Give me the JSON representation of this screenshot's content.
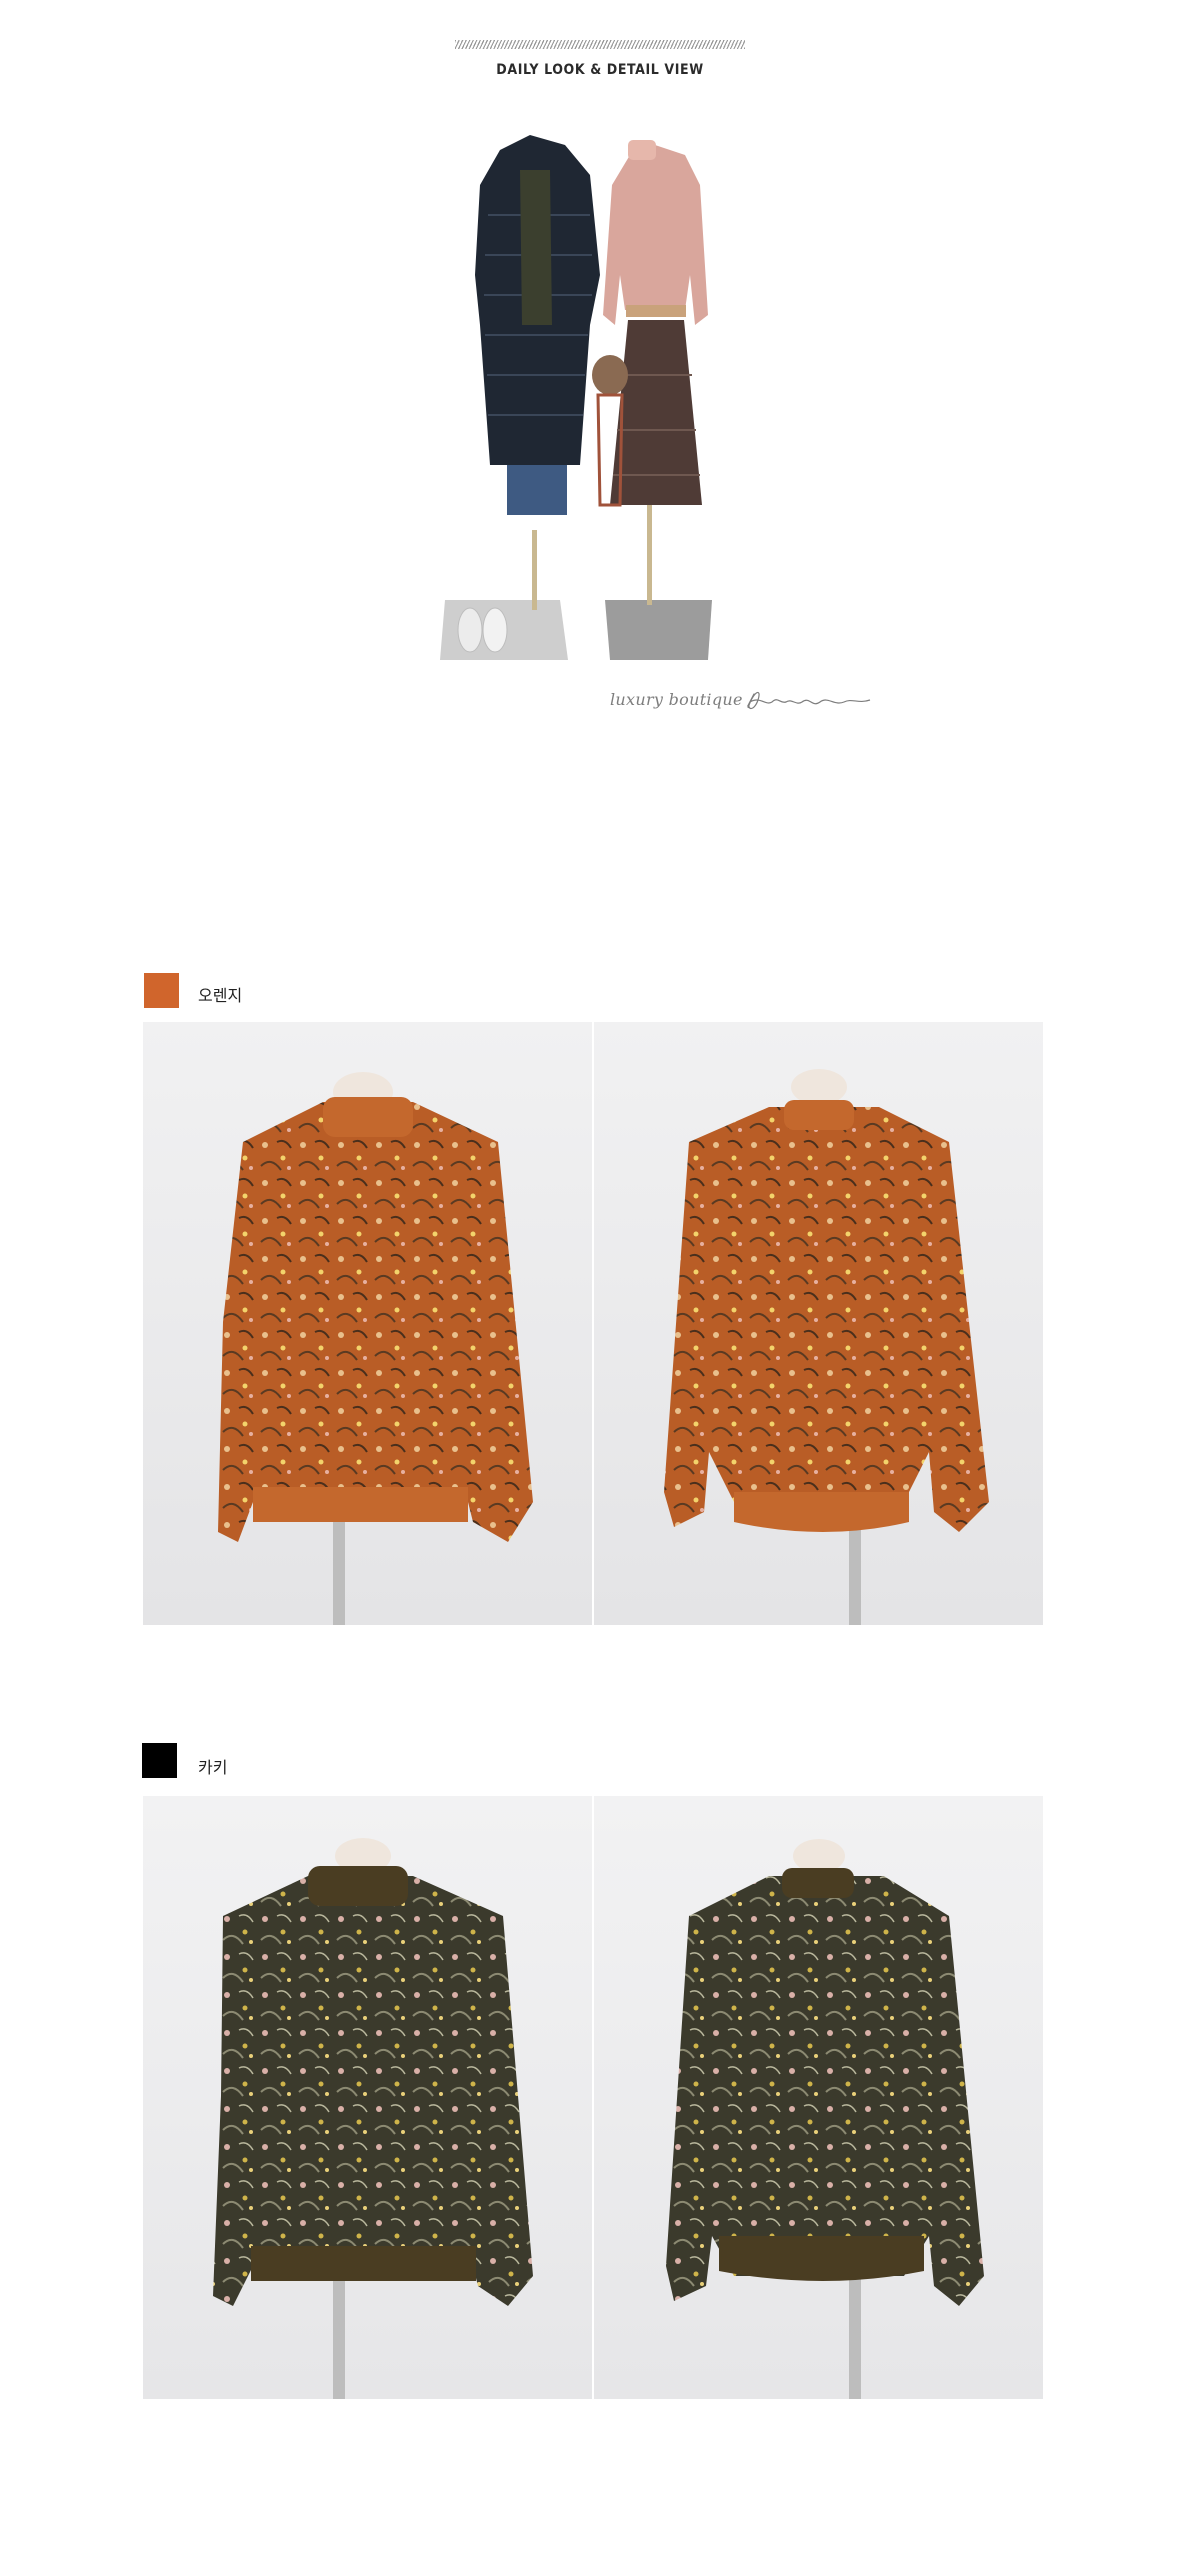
{
  "header": {
    "title": "DAILY LOOK & DETAIL VIEW"
  },
  "signature": {
    "text": "luxury boutique /",
    "logo": "Jblanc"
  },
  "colors_section": [
    {
      "name": "오렌지",
      "swatch_color": "#d0652c",
      "photo_alt": [
        "orange-front",
        "orange-back"
      ]
    },
    {
      "name": "카키",
      "swatch_color": "#000000",
      "photo_alt": [
        "khaki-front",
        "khaki-back"
      ]
    }
  ],
  "palette": {
    "orange_body": "#b9612a",
    "orange_rib": "#c4682d",
    "khaki_body": "#3c3b2c",
    "khaki_rib": "#4a3d22",
    "background": "#ffffff"
  }
}
